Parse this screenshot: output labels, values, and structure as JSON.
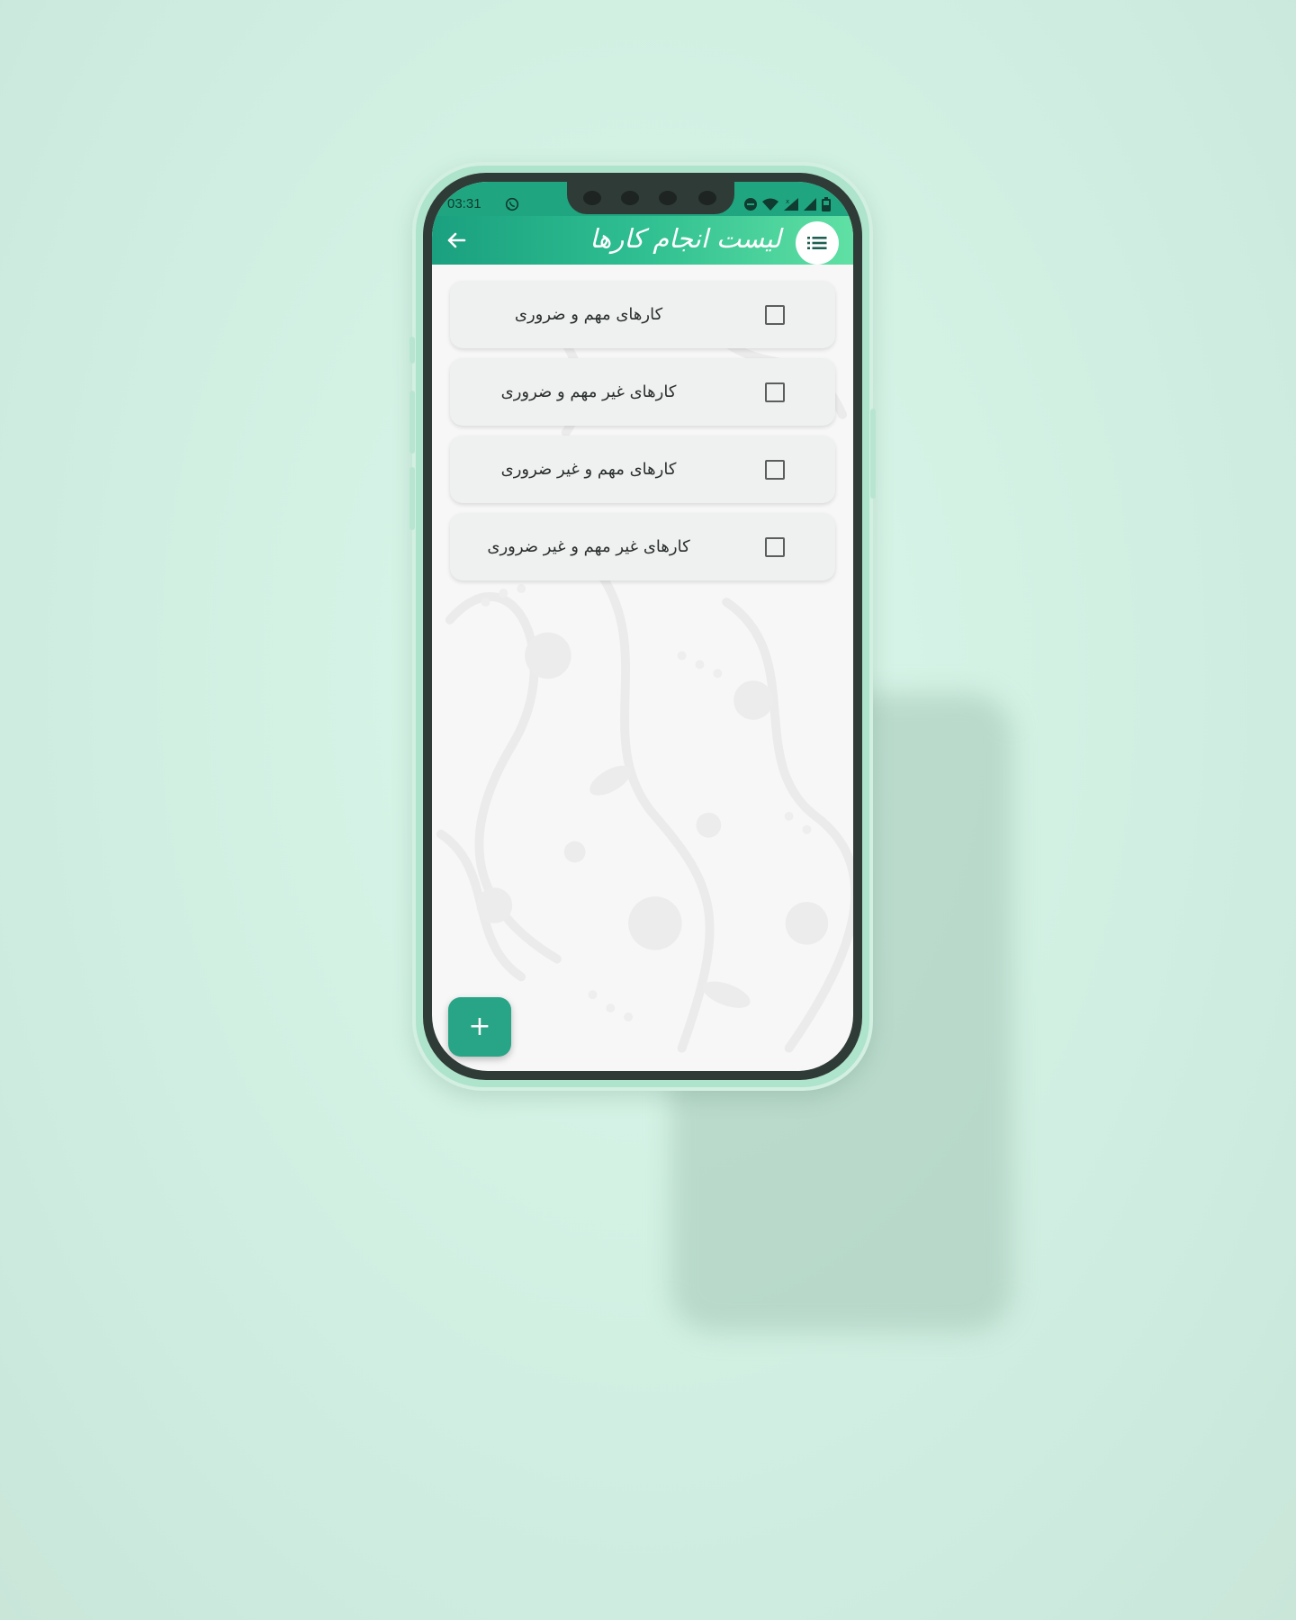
{
  "status_bar": {
    "time": "03:31",
    "app_icon": "whatsapp-icon",
    "icons": [
      "do-not-disturb-icon",
      "wifi-icon",
      "signal-icon",
      "signal-icon",
      "battery-icon"
    ]
  },
  "toolbar": {
    "title": "لیست انجام کارها",
    "back_icon": "arrow-left-icon",
    "menu_icon": "list-icon"
  },
  "tasks": [
    {
      "label": "کارهای مهم و ضروری",
      "checked": false
    },
    {
      "label": "کارهای غیر مهم و ضروری",
      "checked": false
    },
    {
      "label": "کارهای مهم و غیر ضروری",
      "checked": false
    },
    {
      "label": "کارهای غیر مهم و غیر ضروری",
      "checked": false
    }
  ],
  "fab": {
    "label": "+",
    "icon": "plus-icon"
  },
  "colors": {
    "background": "#d2f1e3",
    "status_bar": "#1fa57f",
    "toolbar_start": "#1aa07f",
    "toolbar_end": "#60e0a4",
    "card": "#eef1f0",
    "fab": "#27a586",
    "phone_frame": "#aee3cc"
  }
}
